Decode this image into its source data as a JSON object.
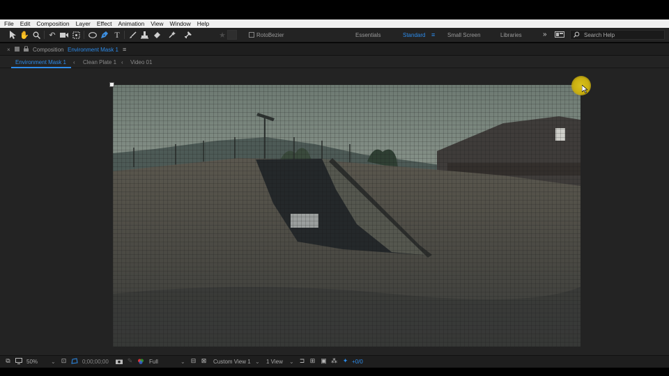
{
  "menu": [
    "File",
    "Edit",
    "Composition",
    "Layer",
    "Effect",
    "Animation",
    "View",
    "Window",
    "Help"
  ],
  "toolbar": {
    "rotobezier_label": "RotoBezier",
    "workspaces": [
      "Essentials",
      "Standard",
      "Small Screen",
      "Libraries"
    ],
    "active_workspace": "Standard",
    "search_placeholder": "Search Help",
    "accent_color": "#2d8ceb"
  },
  "panel": {
    "prefix": "Composition",
    "name": "Environment Mask 1"
  },
  "breadcrumbs": [
    "Environment Mask 1",
    "Clean Plate 1",
    "Video 01"
  ],
  "status": {
    "zoom": "50%",
    "timecode": "0;00;00;00",
    "resolution": "Full",
    "view": "Custom View 1",
    "views_count": "1 View",
    "exposure": "+0/0"
  }
}
